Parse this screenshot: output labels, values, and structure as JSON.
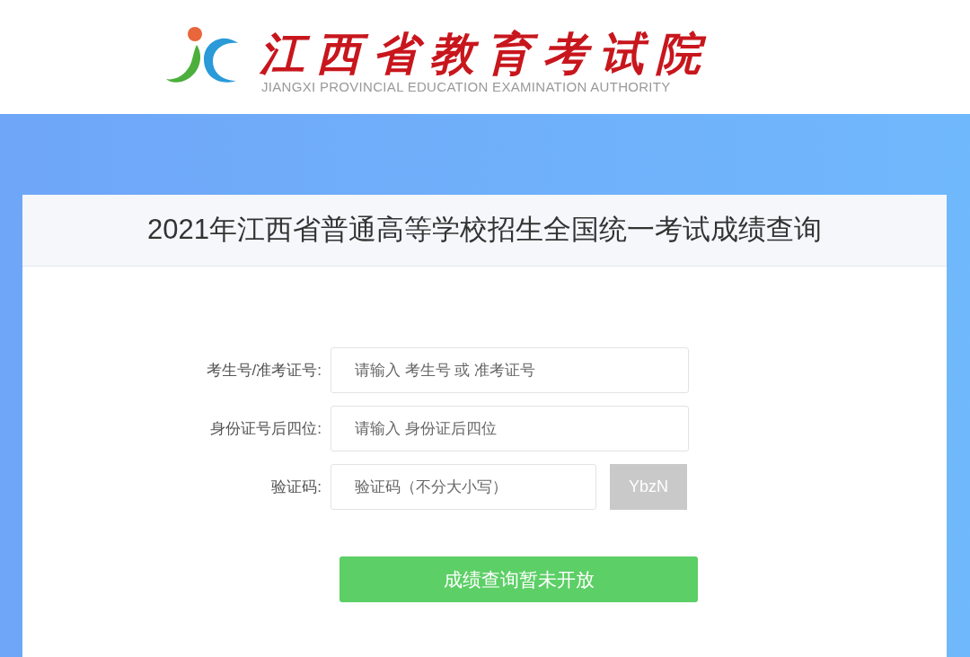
{
  "header": {
    "logo_title": "江西省教育考试院",
    "logo_subtitle": "JIANGXI PROVINCIAL EDUCATION EXAMINATION AUTHORITY"
  },
  "card": {
    "title": "2021年江西省普通高等学校招生全国统一考试成绩查询"
  },
  "fields": [
    {
      "kind": "text",
      "label": "考生号/准考证号:",
      "placeholder": "请输入 考生号 或 准考证号"
    },
    {
      "kind": "text",
      "label": "身份证号后四位:",
      "placeholder": "请输入 身份证后四位"
    },
    {
      "kind": "captcha",
      "label": "验证码:",
      "placeholder": "验证码（不分大小写）",
      "code": "YbzN"
    }
  ],
  "submit_button": "成绩查询暂未开放"
}
